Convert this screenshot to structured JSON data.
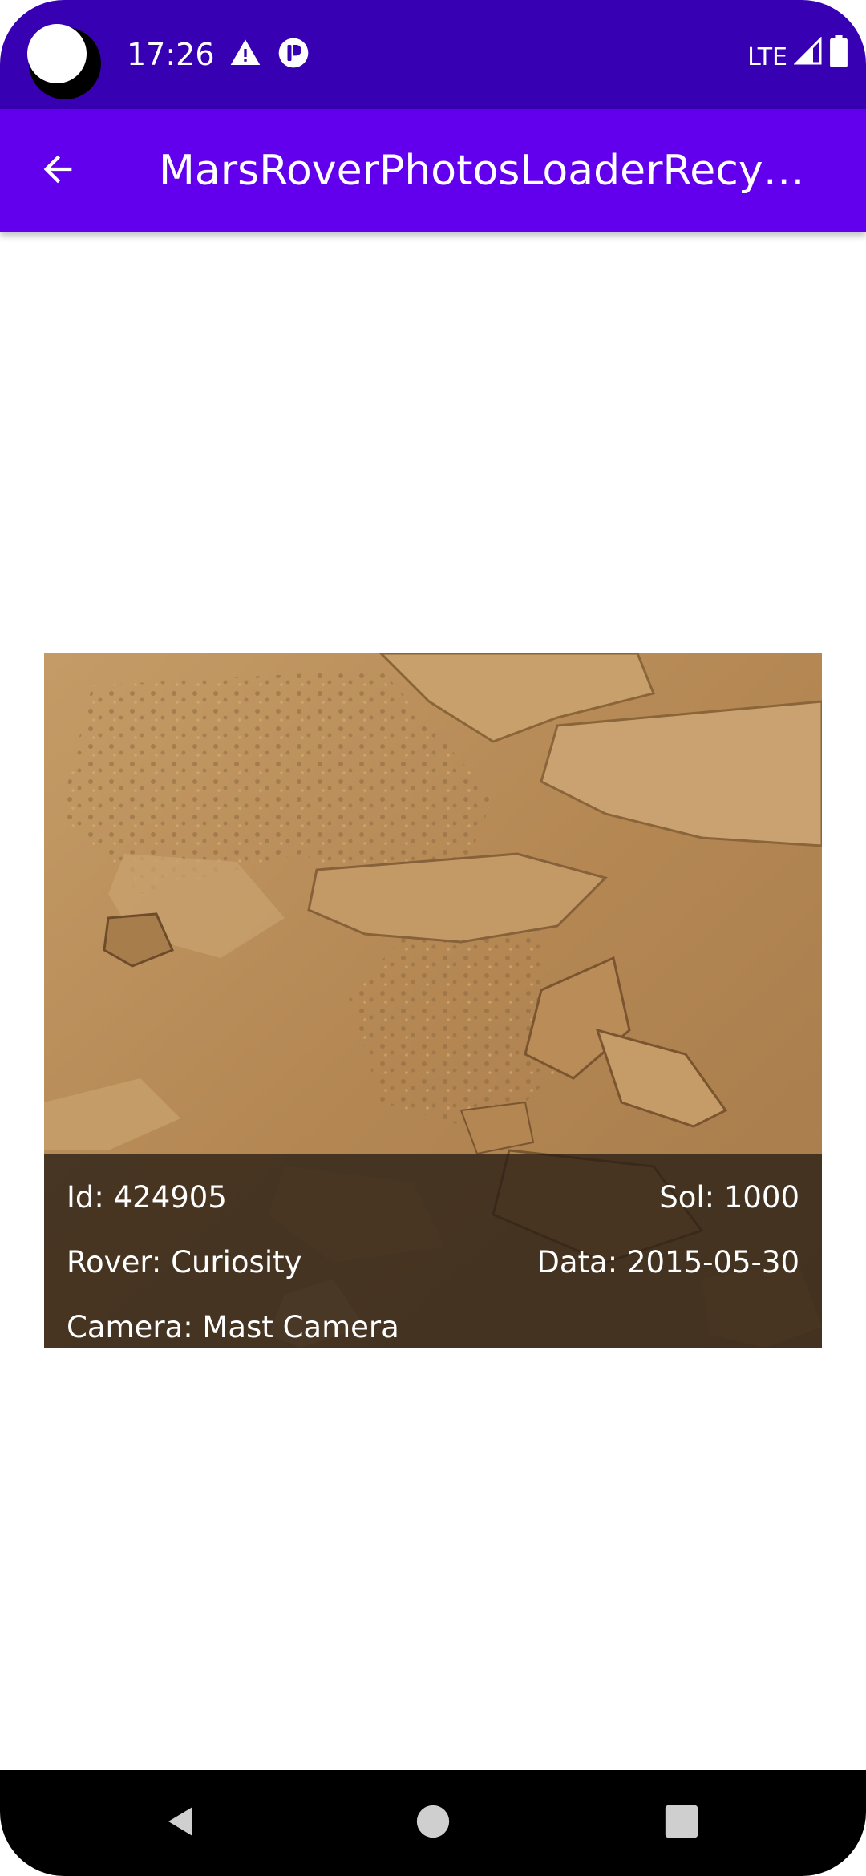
{
  "status_bar": {
    "time": "17:26",
    "network": "LTE",
    "icons": [
      "warning-icon",
      "notification-app-icon",
      "signal-icon",
      "battery-icon"
    ]
  },
  "app_bar": {
    "title": "MarsRoverPhotosLoaderRecyc…",
    "back_icon": "arrow-back-icon"
  },
  "photo": {
    "id_text": "Id: 424905",
    "sol_text": "Sol: 1000",
    "rover_text": "Rover: Curiosity",
    "date_text": "Data: 2015-05-30",
    "camera_text": "Camera: Mast Camera"
  },
  "nav_bar": {
    "icons": [
      "nav-back-icon",
      "nav-home-icon",
      "nav-recents-icon"
    ]
  },
  "colors": {
    "status_bar": "#3700b3",
    "app_bar": "#6200ee",
    "overlay": "#281e14"
  }
}
